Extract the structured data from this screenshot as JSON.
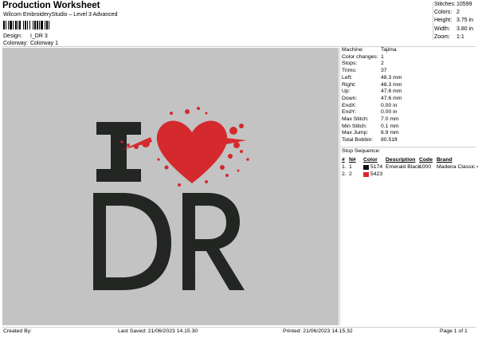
{
  "header": {
    "title": "Production Worksheet",
    "subtitle": "Wilcom EmbroideryStudio – Level 3 Advanced"
  },
  "design_info": [
    {
      "label": "Design:",
      "value": "I_DR 3"
    },
    {
      "label": "Colorway:",
      "value": "Colorway 1"
    }
  ],
  "stats": [
    {
      "label": "Stitches:",
      "value": "10599"
    },
    {
      "label": "Colors:",
      "value": "2"
    },
    {
      "label": "Height:",
      "value": "3.75 in"
    },
    {
      "label": "Width:",
      "value": "3.80 in"
    },
    {
      "label": "Zoom:",
      "value": "1:1"
    }
  ],
  "machine_info": [
    {
      "label": "Machine:",
      "value": "Tajima"
    },
    {
      "label": "Color changes:",
      "value": "1"
    },
    {
      "label": "Stops:",
      "value": "2"
    },
    {
      "label": "Trims:",
      "value": "37"
    },
    {
      "label": "Left:",
      "value": "48.3 mm"
    },
    {
      "label": "Right:",
      "value": "48.3 mm"
    },
    {
      "label": "Up:",
      "value": "47.6 mm"
    },
    {
      "label": "Down:",
      "value": "47.6 mm"
    },
    {
      "label": "EndX:",
      "value": "0.00 in"
    },
    {
      "label": "EndY:",
      "value": "0.00 in"
    },
    {
      "label": "Max Stitch:",
      "value": "7.0 mm"
    },
    {
      "label": "Min Stitch:",
      "value": "0.1 mm"
    },
    {
      "label": "Max Jump:",
      "value": "6.9 mm"
    },
    {
      "label": "Total Bobbin:",
      "value": "80.51ft"
    }
  ],
  "stop_sequence": {
    "title": "Stop Sequence:",
    "headers": [
      "#",
      "N#",
      "Color",
      "Description",
      "Code",
      "Brand"
    ],
    "rows": [
      {
        "idx": "1.",
        "n": "1",
        "swatch": "#111111",
        "color": "5174",
        "description": "Emerald Black",
        "code": "1000",
        "brand": "Madeira Classic 40"
      },
      {
        "idx": "2.",
        "n": "2",
        "swatch": "#e0262b",
        "color": "5423",
        "description": "",
        "code": "",
        "brand": ""
      }
    ]
  },
  "design": {
    "line1": "I",
    "line2": "DR",
    "text_color": "#1f221f",
    "heart_color": "#d42a2e",
    "canvas_color": "#c3c3c3"
  },
  "footer": {
    "created_by": "Created By:",
    "last_saved": "Last Saved: 21/06/2023 14.15.30",
    "printed": "Printed: 21/06/2023 14.15.32",
    "page": "Page 1 of 1"
  }
}
